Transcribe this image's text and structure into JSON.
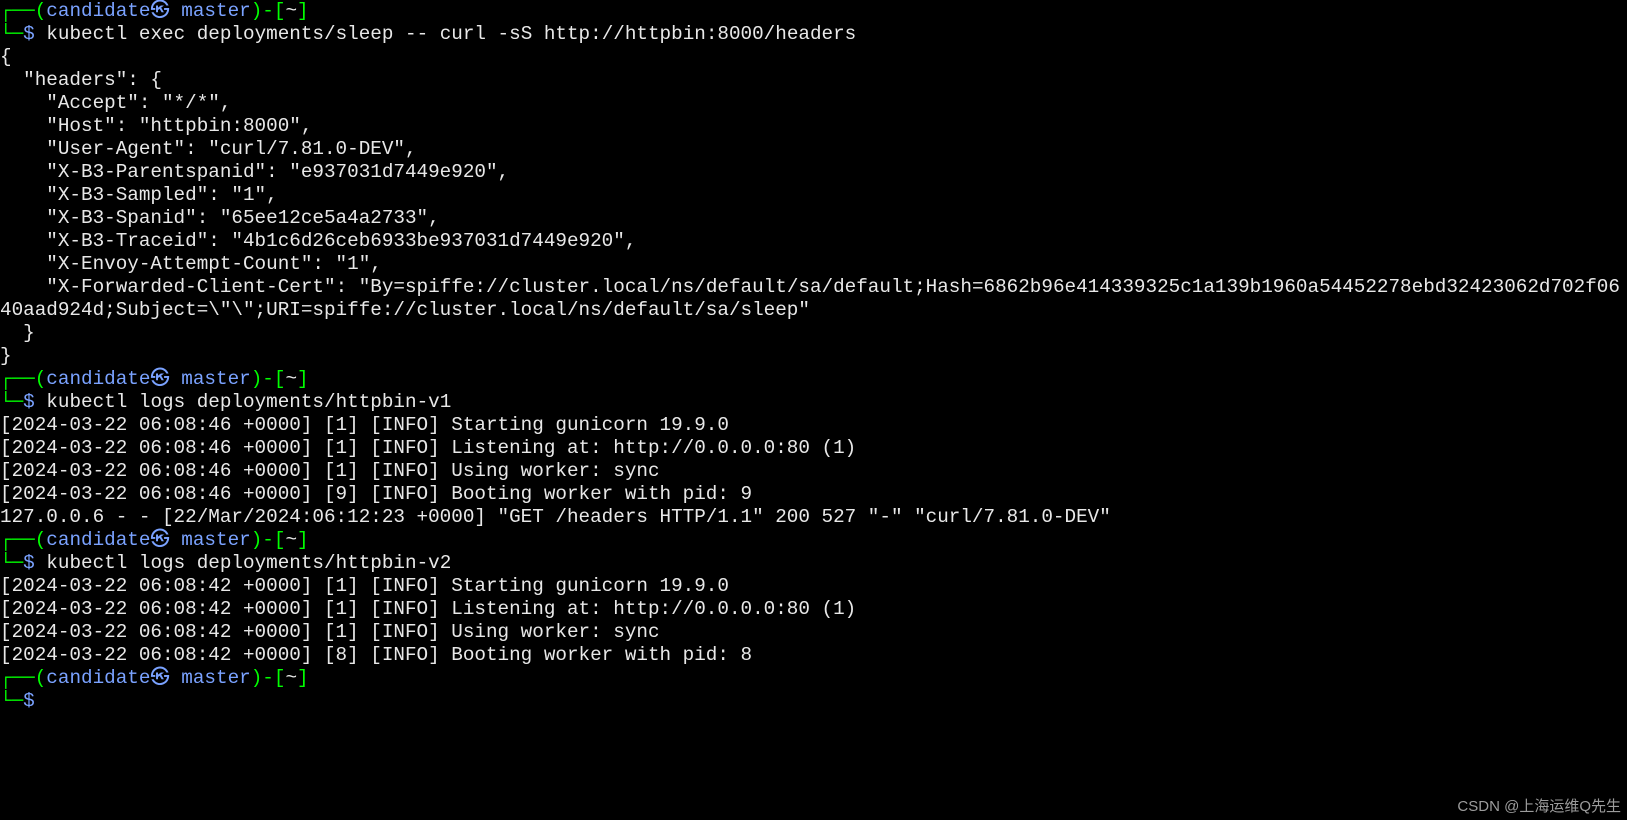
{
  "prompt": {
    "l1a": "┌──(",
    "user_host": "candidate㉿ master",
    "l1b": ")-[",
    "cwd": "~",
    "l1c": "]",
    "l2a": "└─",
    "l2b": "$"
  },
  "blocks": [
    {
      "cmd": " kubectl exec deployments/sleep -- curl -sS http://httpbin:8000/headers",
      "out": [
        "{",
        "  \"headers\": {",
        "    \"Accept\": \"*/*\",",
        "    \"Host\": \"httpbin:8000\",",
        "    \"User-Agent\": \"curl/7.81.0-DEV\",",
        "    \"X-B3-Parentspanid\": \"e937031d7449e920\",",
        "    \"X-B3-Sampled\": \"1\",",
        "    \"X-B3-Spanid\": \"65ee12ce5a4a2733\",",
        "    \"X-B3-Traceid\": \"4b1c6d26ceb6933be937031d7449e920\",",
        "    \"X-Envoy-Attempt-Count\": \"1\",",
        "    \"X-Forwarded-Client-Cert\": \"By=spiffe://cluster.local/ns/default/sa/default;Hash=6862b96e414339325c1a139b1960a54452278ebd32423062d702f0640aad924d;Subject=\\\"\\\";URI=spiffe://cluster.local/ns/default/sa/sleep\"",
        "  }",
        "}",
        ""
      ]
    },
    {
      "cmd": " kubectl logs deployments/httpbin-v1",
      "out": [
        "[2024-03-22 06:08:46 +0000] [1] [INFO] Starting gunicorn 19.9.0",
        "[2024-03-22 06:08:46 +0000] [1] [INFO] Listening at: http://0.0.0.0:80 (1)",
        "[2024-03-22 06:08:46 +0000] [1] [INFO] Using worker: sync",
        "[2024-03-22 06:08:46 +0000] [9] [INFO] Booting worker with pid: 9",
        "127.0.0.6 - - [22/Mar/2024:06:12:23 +0000] \"GET /headers HTTP/1.1\" 200 527 \"-\" \"curl/7.81.0-DEV\"",
        ""
      ]
    },
    {
      "cmd": " kubectl logs deployments/httpbin-v2",
      "out": [
        "[2024-03-22 06:08:42 +0000] [1] [INFO] Starting gunicorn 19.9.0",
        "[2024-03-22 06:08:42 +0000] [1] [INFO] Listening at: http://0.0.0.0:80 (1)",
        "[2024-03-22 06:08:42 +0000] [1] [INFO] Using worker: sync",
        "[2024-03-22 06:08:42 +0000] [8] [INFO] Booting worker with pid: 8",
        ""
      ]
    },
    {
      "cmd": "",
      "out": []
    }
  ],
  "watermark": "CSDN @上海运维Q先生"
}
